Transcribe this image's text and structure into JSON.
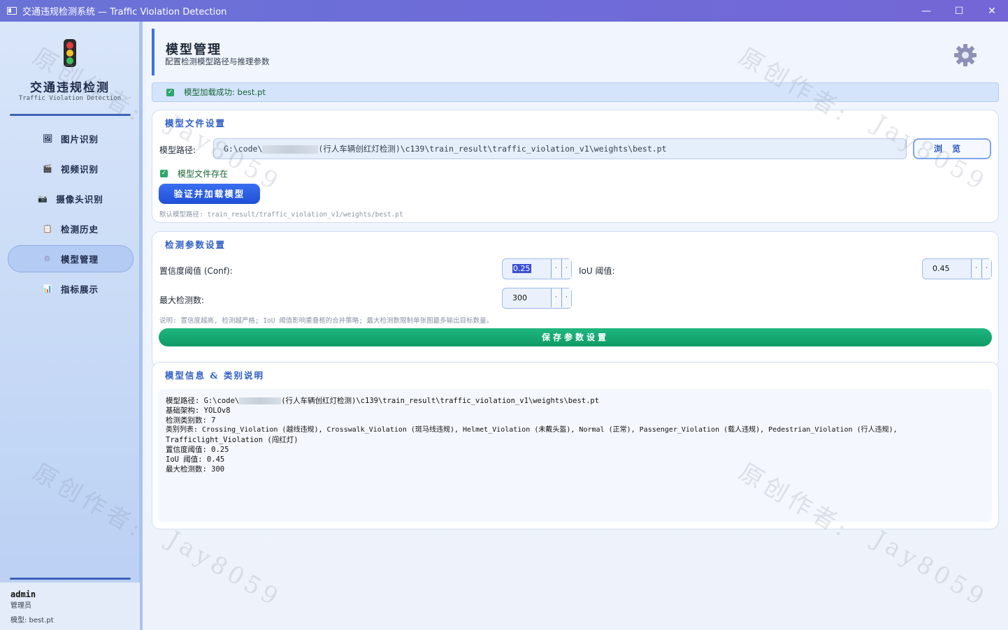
{
  "window": {
    "title": "交通违规检测系统 — Traffic Violation Detection",
    "minimize": "—",
    "maximize": "☐",
    "close": "✕"
  },
  "sidebar": {
    "brand_title": "交通违规检测",
    "brand_subtitle": "Traffic Violation Detection",
    "items": [
      {
        "label": "图片识别",
        "icon": "image-icon",
        "glyph": "🖼"
      },
      {
        "label": "视频识别",
        "icon": "clapper-icon",
        "glyph": "🎬"
      },
      {
        "label": "摄像头识别",
        "icon": "camera-icon",
        "glyph": "📷"
      },
      {
        "label": "检测历史",
        "icon": "clipboard-icon",
        "glyph": "📋"
      },
      {
        "label": "模型管理",
        "icon": "gear-icon",
        "glyph": "⚙"
      },
      {
        "label": "指标展示",
        "icon": "bar-chart-icon",
        "glyph": "📊"
      }
    ],
    "active_index": 4,
    "user": "admin",
    "role": "管理员",
    "model": "模型: best.pt"
  },
  "header": {
    "title": "模型管理",
    "subtitle": "配置检测模型路径与推理参数"
  },
  "status": {
    "text": "模型加载成功: best.pt"
  },
  "model_file": {
    "title": "模型文件设置",
    "path_label": "模型路径:",
    "path_prefix": "G:\\code\\",
    "path_suffix": "(行人车辆创红灯检测)\\c139\\train_result\\traffic_violation_v1\\weights\\best.pt",
    "browse": "浏览",
    "exists": "模型文件存在",
    "load_button": "验证并加载模型",
    "hint": "默认模型路径: train_result/traffic_violation_v1/weights/best.pt"
  },
  "params": {
    "title": "检测参数设置",
    "conf_label": "置信度阈值 (Conf):",
    "conf_value": "0.25",
    "iou_label": "IoU 阈值:",
    "iou_value": "0.45",
    "max_label": "最大检测数:",
    "max_value": "300",
    "hint": "说明: 置信度越高, 检测越严格; IoU 阈值影响重叠框的合并策略; 最大检测数限制单张图最多输出目标数量。",
    "save_button": "保存参数设置"
  },
  "info": {
    "title": "模型信息 & 类别说明",
    "path_prefix": "模型路径: G:\\code\\",
    "path_suffix": "(行人车辆创红灯检测)\\c139\\train_result\\traffic_violation_v1\\weights\\best.pt",
    "lines": [
      "基础架构: YOLOv8",
      "检测类别数: 7",
      "类别列表: Crossing_Violation (越线违规), Crosswalk_Violation (斑马线违规), Helmet_Violation (未戴头盔), Normal (正常), Passenger_Violation (载人违规), Pedestrian_Violation (行人违规),",
      "Trafficlight_Violation (闯红灯)",
      "置信度阈值: 0.25",
      "IoU 阈值: 0.45",
      "最大检测数: 300"
    ]
  },
  "watermarks": [
    "原创作者:",
    "Jay8059"
  ],
  "colors": {
    "accent": "#3b72de",
    "success": "#16a34a",
    "save": "#10a36e",
    "titlebar": "#6e6cd8"
  }
}
